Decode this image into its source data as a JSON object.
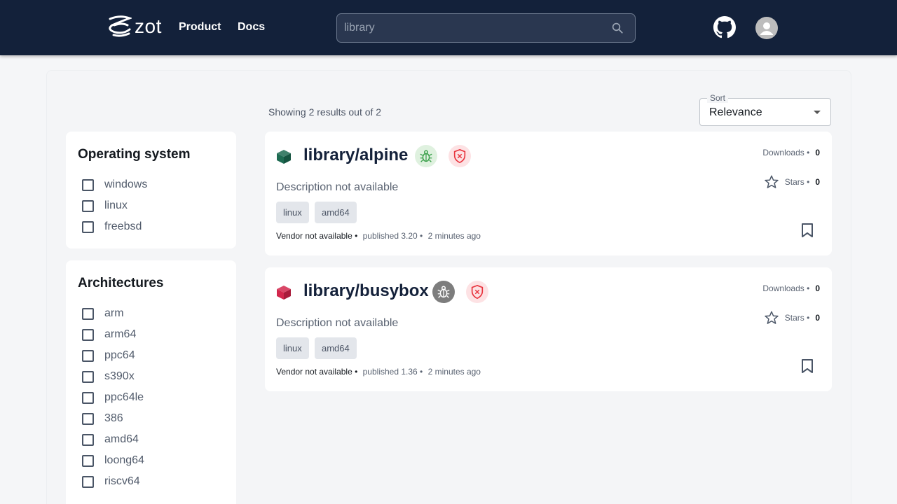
{
  "header": {
    "logo_text": "zot",
    "nav": [
      "Product",
      "Docs"
    ],
    "search": {
      "value": "",
      "placeholder": "library"
    },
    "icons": [
      "search-icon",
      "github-icon",
      "user-avatar-icon"
    ]
  },
  "filters": {
    "os": {
      "title": "Operating system",
      "items": [
        "windows",
        "linux",
        "freebsd"
      ]
    },
    "arch": {
      "title": "Architectures",
      "items": [
        "arm",
        "arm64",
        "ppc64",
        "s390x",
        "ppc64le",
        "386",
        "amd64",
        "loong64",
        "riscv64"
      ]
    }
  },
  "results": {
    "count_text": "Showing 2 results out of 2",
    "sort": {
      "label": "Sort",
      "value": "Relevance"
    }
  },
  "cards": [
    {
      "title": "library/alpine",
      "cube_color": "#1e6b52",
      "bug_badge": "bug-clean-icon",
      "shield_badge": "shield-x-icon",
      "description": "Description not available",
      "tags": [
        "linux",
        "amd64"
      ],
      "vendor": "Vendor not available",
      "published": "published 3.20",
      "time": "2 minutes ago",
      "downloads_label": "Downloads",
      "downloads": "0",
      "stars_label": "Stars",
      "stars": "0"
    },
    {
      "title": "library/busybox",
      "cube_color": "#d2274c",
      "bug_badge": "bug-unknown-icon",
      "shield_badge": "shield-x-icon",
      "description": "Description not available",
      "tags": [
        "linux",
        "amd64"
      ],
      "vendor": "Vendor not available",
      "published": "published 1.36",
      "time": "2 minutes ago",
      "downloads_label": "Downloads",
      "downloads": "0",
      "stars_label": "Stars",
      "stars": "0"
    }
  ]
}
